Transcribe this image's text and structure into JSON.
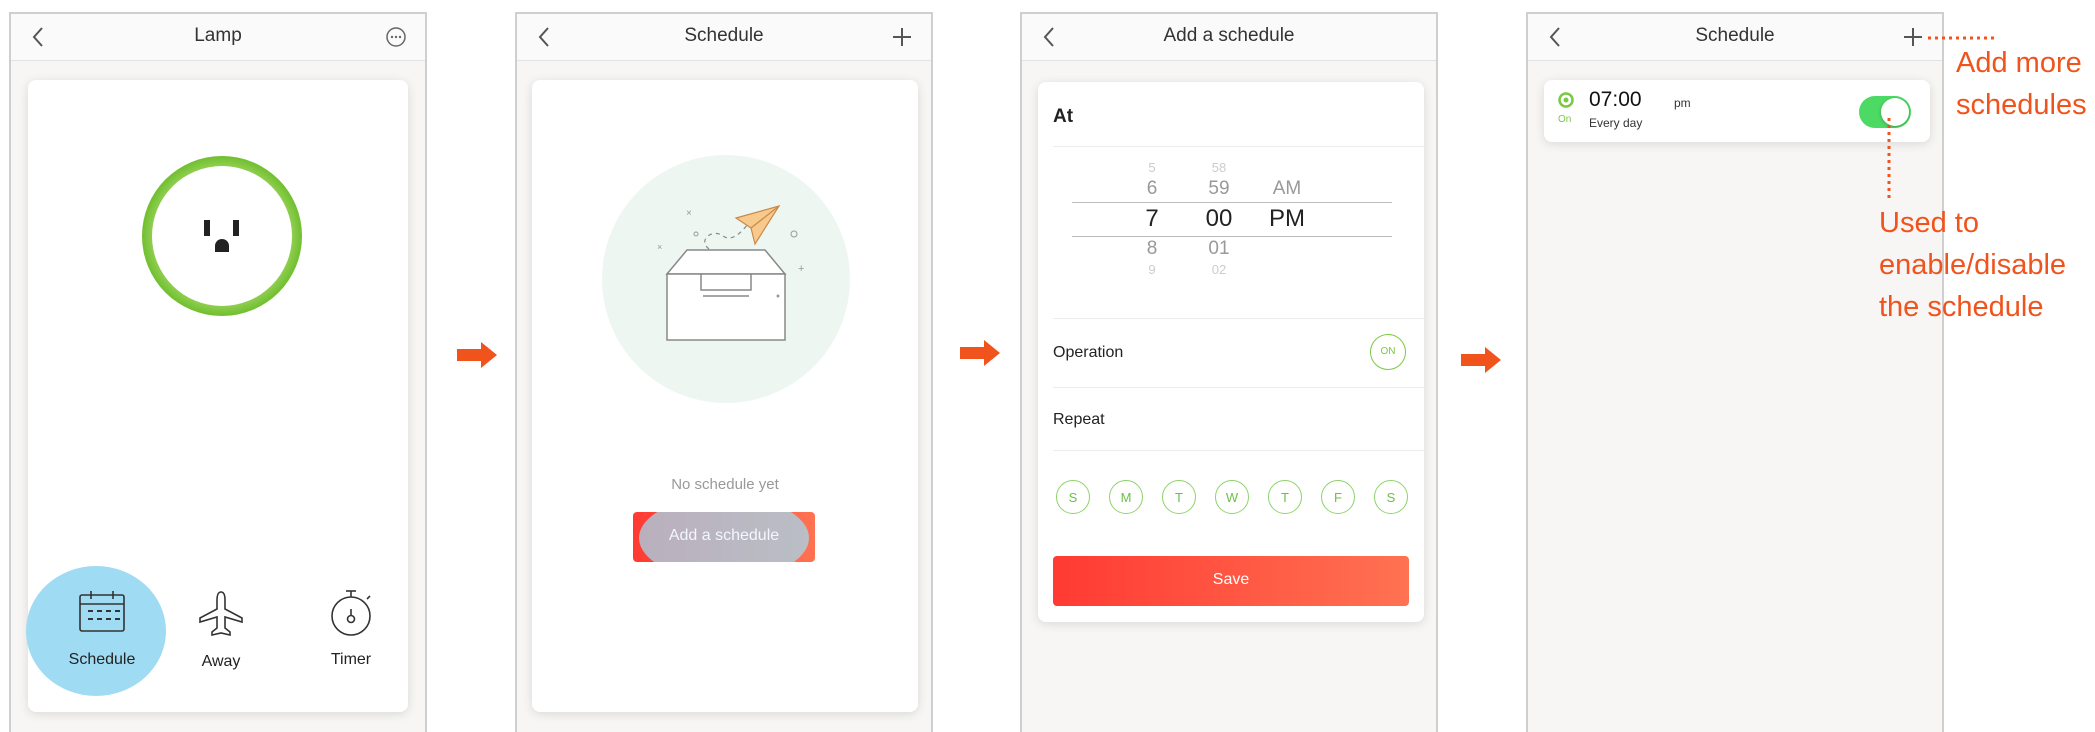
{
  "colors": {
    "accent_green": "#7ac943",
    "accent_red": "#ff4136",
    "annotation": "#f0531c",
    "highlight": "#9fdcf3"
  },
  "screen1": {
    "title": "Lamp",
    "tabs": [
      "Schedule",
      "Away",
      "Timer"
    ],
    "icons": [
      "back-chevron-icon",
      "more-icon",
      "socket-icon",
      "calendar-icon",
      "airplane-icon",
      "stopwatch-icon"
    ]
  },
  "screen2": {
    "title": "Schedule",
    "empty_text": "No schedule yet",
    "add_button": "Add a schedule"
  },
  "screen3": {
    "title": "Add a schedule",
    "at_label": "At",
    "picker": {
      "hours": [
        "5",
        "6",
        "7",
        "8",
        "9"
      ],
      "minutes": [
        "58",
        "59",
        "00",
        "01",
        "02"
      ],
      "ampm": [
        "AM",
        "PM"
      ]
    },
    "operation_label": "Operation",
    "operation_state": "ON",
    "repeat_label": "Repeat",
    "days": [
      "S",
      "M",
      "T",
      "W",
      "T",
      "F",
      "S"
    ],
    "save_button": "Save"
  },
  "screen4": {
    "title": "Schedule",
    "item": {
      "time": "07:00",
      "period": "pm",
      "repeat": "Every day",
      "status": "On",
      "enabled": true
    }
  },
  "annotations": {
    "add_more": [
      "Add more",
      "schedules"
    ],
    "toggle": [
      "Used to",
      "enable/disable",
      "the schedule"
    ]
  }
}
